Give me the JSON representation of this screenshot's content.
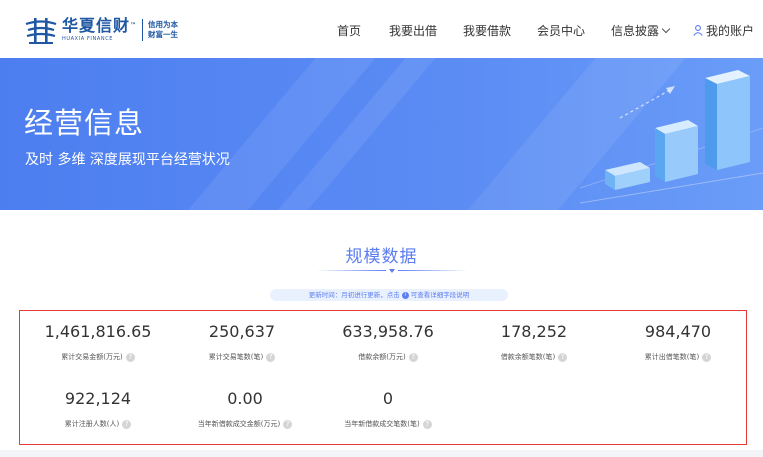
{
  "header": {
    "logo_cn": "华夏信财",
    "logo_tm": "™",
    "logo_en": "HUAXIA FINANCE",
    "slogan_line1": "信用为本",
    "slogan_line2": "财富一生",
    "nav": [
      {
        "label": "首页"
      },
      {
        "label": "我要出借"
      },
      {
        "label": "我要借款"
      },
      {
        "label": "会员中心"
      },
      {
        "label": "信息披露"
      },
      {
        "label": "我的账户"
      }
    ]
  },
  "banner": {
    "title": "经营信息",
    "subtitle": "及时 多维 深度展现平台经营状况"
  },
  "section": {
    "title": "规模数据",
    "update_prefix": "更新时间：月初进行更新，点击",
    "update_info": "i",
    "update_suffix": "可查看详细字段说明"
  },
  "stats": [
    {
      "value": "1,461,816.65",
      "label": "累计交易金额(万元)"
    },
    {
      "value": "250,637",
      "label": "累计交易笔数(笔)"
    },
    {
      "value": "633,958.76",
      "label": "借款余额(万元)"
    },
    {
      "value": "178,252",
      "label": "借款余额笔数(笔)"
    },
    {
      "value": "984,470",
      "label": "累计出借笔数(笔)"
    },
    {
      "value": "922,124",
      "label": "累计注册人数(人)"
    },
    {
      "value": "0.00",
      "label": "当年新借款成交金额(万元)"
    },
    {
      "value": "0",
      "label": "当年新借款成交笔数(笔)"
    }
  ],
  "help_glyph": "?",
  "colors": {
    "brand_blue": "#1f57a3",
    "banner_blue": "#5b8cf4",
    "accent": "#5b7df0",
    "highlight_border": "#e53935"
  }
}
